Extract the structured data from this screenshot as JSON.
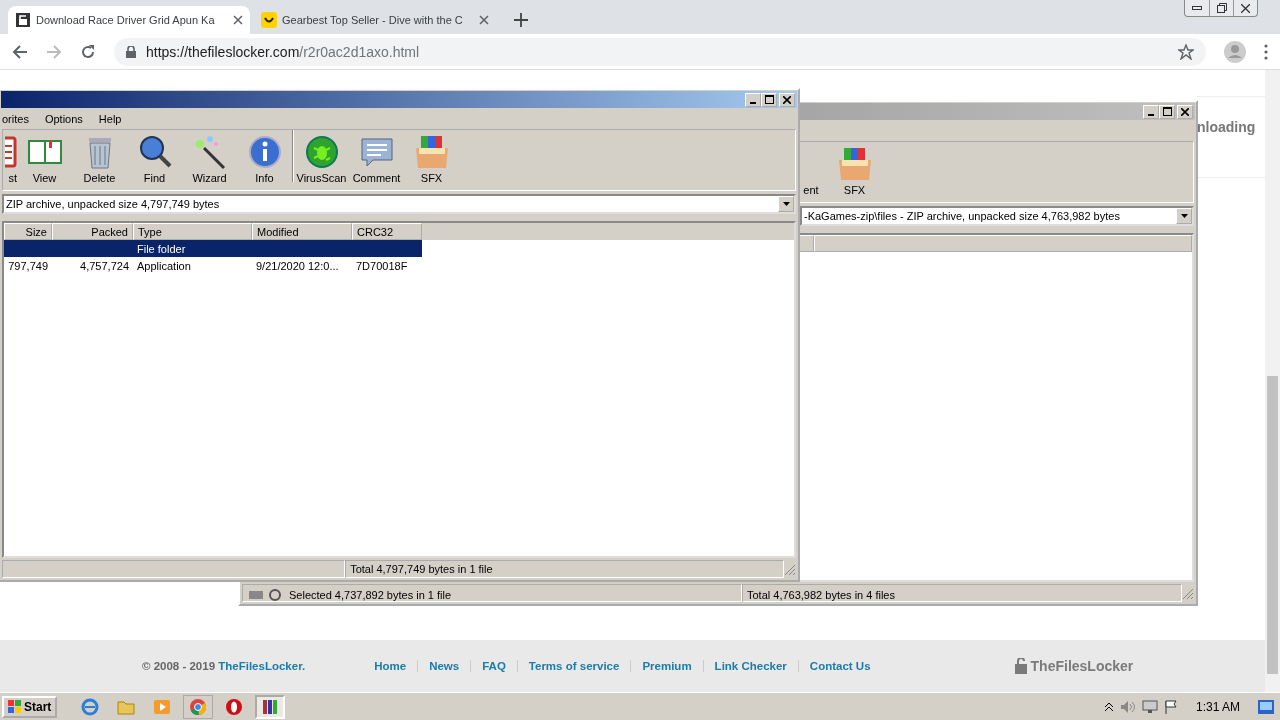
{
  "browser": {
    "tabs": [
      {
        "title": "Download Race Driver Grid Apun Ka",
        "selected": true,
        "kind": "page"
      },
      {
        "title": "Gearbest Top Seller - Dive with the C",
        "selected": false,
        "kind": "shop"
      }
    ],
    "url_host": "https://thefileslocker.com",
    "url_path": "/r2r0ac2d1axo.html"
  },
  "page": {
    "side_text": "nloading",
    "footer": {
      "copyright": "© 2008 - 2019 ",
      "brand": "TheFilesLocker.",
      "links": [
        "Home",
        "News",
        "FAQ",
        "Terms of service",
        "Premium",
        "Link Checker",
        "Contact Us"
      ],
      "logo": "TheFilesLocker"
    }
  },
  "back_window": {
    "active": false,
    "toolbar": [
      {
        "label": "ent",
        "kind": "partial"
      },
      {
        "label": "SFX",
        "kind": "sfx"
      }
    ],
    "path": "-KaGames-zip\\files - ZIP archive, unpacked size 4,763,982 bytes",
    "status": [
      "Selected 4,737,892 bytes in 1 file",
      "Total 4,763,982 bytes in 4 files"
    ]
  },
  "front_window": {
    "active": true,
    "menu": [
      "orites",
      "Options",
      "Help"
    ],
    "toolbar": [
      {
        "label": "st",
        "kind": "list"
      },
      {
        "label": "View",
        "kind": "view"
      },
      {
        "label": "Delete",
        "kind": "delete"
      },
      {
        "label": "Find",
        "kind": "find"
      },
      {
        "label": "Wizard",
        "kind": "wizard"
      },
      {
        "label": "Info",
        "kind": "info"
      },
      {
        "kind": "separator"
      },
      {
        "label": "VirusScan",
        "kind": "virus"
      },
      {
        "label": "Comment",
        "kind": "comment"
      },
      {
        "label": "SFX",
        "kind": "sfx"
      }
    ],
    "path": "ZIP archive, unpacked size 4,797,749 bytes",
    "columns": [
      "Size",
      "Packed",
      "Type",
      "Modified",
      "CRC32"
    ],
    "rows": [
      {
        "type": "File folder",
        "selected": true
      },
      {
        "size": "797,749",
        "packed": "4,757,724",
        "type": "Application",
        "modified": "9/21/2020 12:0...",
        "crc": "7D70018F",
        "selected": false
      }
    ],
    "status": "Total 4,797,749 bytes in 1 file"
  },
  "taskbar": {
    "start": "Start",
    "apps": [
      {
        "kind": "ie",
        "running": false,
        "selected": false
      },
      {
        "kind": "folder",
        "running": false,
        "selected": false
      },
      {
        "kind": "media",
        "running": false,
        "selected": false
      },
      {
        "kind": "chrome",
        "running": true,
        "selected": false
      },
      {
        "kind": "opera",
        "running": false,
        "selected": false
      },
      {
        "kind": "winrar",
        "running": true,
        "selected": true
      }
    ],
    "clock": "1:31 AM"
  }
}
